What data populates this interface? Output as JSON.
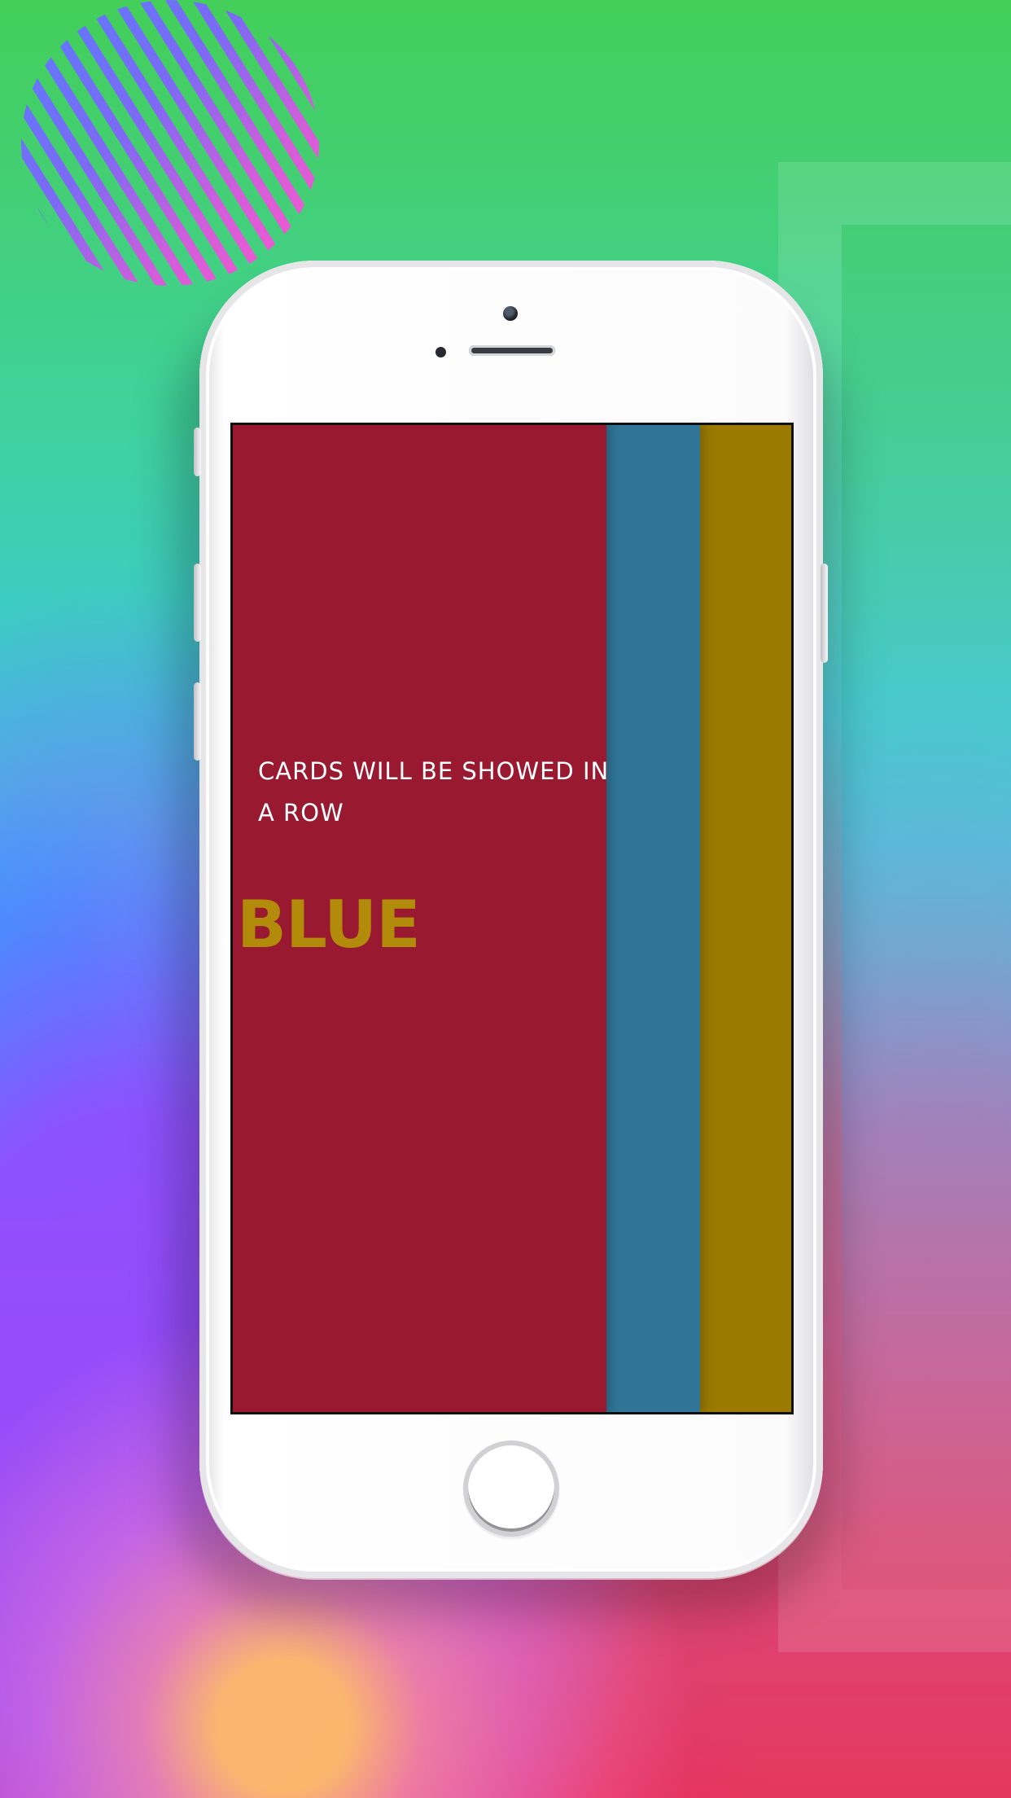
{
  "screen": {
    "caption": "CARDS WILL BE SHOWED IN A ROW",
    "word": "BLUE",
    "cards": [
      {
        "name": "red-card",
        "color": "#991a30"
      },
      {
        "name": "blue-card",
        "color": "#307597"
      },
      {
        "name": "gold-card",
        "color": "#9a7a00"
      }
    ]
  },
  "colors": {
    "word": "#b28b0b",
    "caption": "#ffffff"
  },
  "icons": {
    "camera": "camera-icon",
    "speaker": "speaker-icon",
    "home": "home-button-icon",
    "decorative_circle": "striped-circle-icon"
  }
}
